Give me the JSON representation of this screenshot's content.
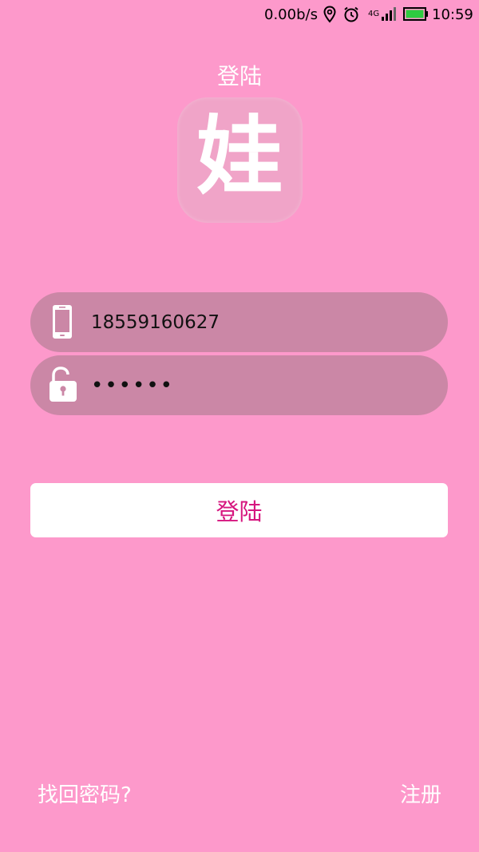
{
  "status_bar": {
    "network_speed": "0.00b/s",
    "network_type": "4G",
    "time": "10:59",
    "icons": [
      "location-icon",
      "alarm-icon",
      "signal-icon",
      "battery-icon"
    ],
    "battery_color": "#2ecc40"
  },
  "header": {
    "title": "登陆"
  },
  "logo": {
    "text": "娃"
  },
  "form": {
    "phone": {
      "value": "18559160627",
      "icon": "phone-icon"
    },
    "password": {
      "value": "••••••",
      "icon": "lock-icon"
    },
    "submit_label": "登陆"
  },
  "footer": {
    "forgot_password": "找回密码?",
    "register": "注册"
  },
  "colors": {
    "background": "#fd99cb",
    "field_background": "#cb87a6",
    "button_background": "#ffffff",
    "button_text": "#d6167f",
    "logo_background": "#f0a4c8"
  }
}
